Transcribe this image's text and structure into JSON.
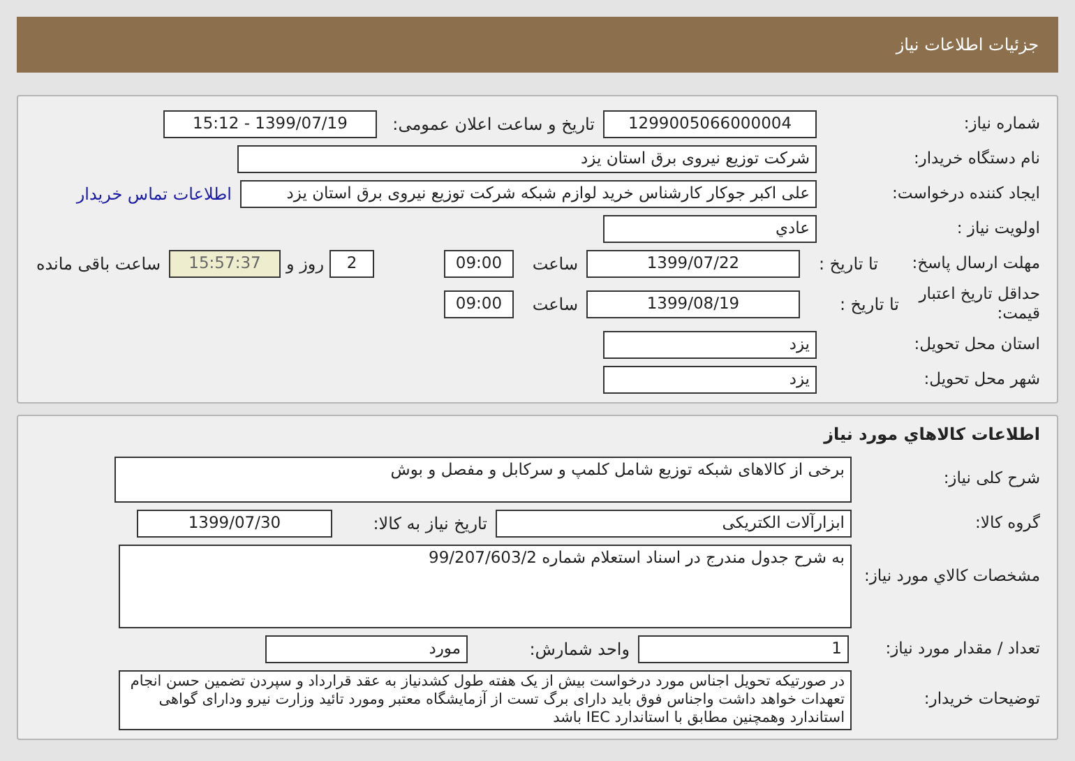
{
  "header": {
    "title": "جزئیات اطلاعات نیاز"
  },
  "details": {
    "need_number": {
      "label": "شماره نیاز:",
      "value": "1299005066000004"
    },
    "announce": {
      "label": "تاریخ و ساعت اعلان عمومی:",
      "value": "1399/07/19 - 15:12"
    },
    "buyer": {
      "label": "نام دستگاه خریدار:",
      "value": "شرکت توزیع نیروی برق استان یزد"
    },
    "creator": {
      "label": "ایجاد کننده درخواست:",
      "value": "علی اکبر  جوکار  کارشناس خرید لوازم شبکه  شرکت توزیع نیروی برق استان یزد",
      "link": "اطلاعات تماس خریدار"
    },
    "priority": {
      "label": "اولویت نیاز :",
      "value": "عادي"
    },
    "deadline": {
      "label": "مهلت ارسال پاسخ:",
      "to_date": "تا تاریخ :",
      "date": "1399/07/22",
      "time_label": "ساعت",
      "time": "09:00",
      "days": "2",
      "days_label": "روز و",
      "remaining": "15:57:37",
      "remaining_label": "ساعت باقی مانده"
    },
    "validity": {
      "label": "حداقل تاریخ اعتبار قیمت:",
      "to_date": "تا تاریخ :",
      "date": "1399/08/19",
      "time_label": "ساعت",
      "time": "09:00"
    },
    "province": {
      "label": "استان محل تحویل:",
      "value": "یزد"
    },
    "city": {
      "label": "شهر محل تحویل:",
      "value": "یزد"
    }
  },
  "goods": {
    "title": "اطلاعات کالاهاي مورد نیاز",
    "summary": {
      "label": "شرح کلی نیاز:",
      "value": "برخی از کالاهای شبکه توزیع شامل کلمپ و سرکابل و مفصل و بوش"
    },
    "group": {
      "label": "گروه کالا:",
      "value": "ابزارآلات الکتریکی",
      "date_label": "تاریخ نیاز به کالا:",
      "date": "1399/07/30"
    },
    "specs": {
      "label": "مشخصات کالاي مورد نیاز:",
      "value": "به شرح جدول مندرج در اسناد استعلام شماره    99/207/603/2"
    },
    "quantity": {
      "label": "تعداد / مقدار مورد نیاز:",
      "value": "1",
      "unit_label": "واحد شمارش:",
      "unit": "مورد"
    },
    "notes": {
      "label": "توضیحات خریدار:",
      "value": "در صورتیکه تحویل اجناس مورد درخواست بیش از یک هفته طول کشدنیاز به عقد قرارداد و سپردن تضمین حسن انجام تعهدات خواهد داشت واجناس فوق باید دارای برگ تست از آزمایشگاه معتبر ومورد تائید وزارت نیرو ودارای گواهی استاندارد وهمچنین مطابق با استاندارد IEC باشد"
    }
  }
}
